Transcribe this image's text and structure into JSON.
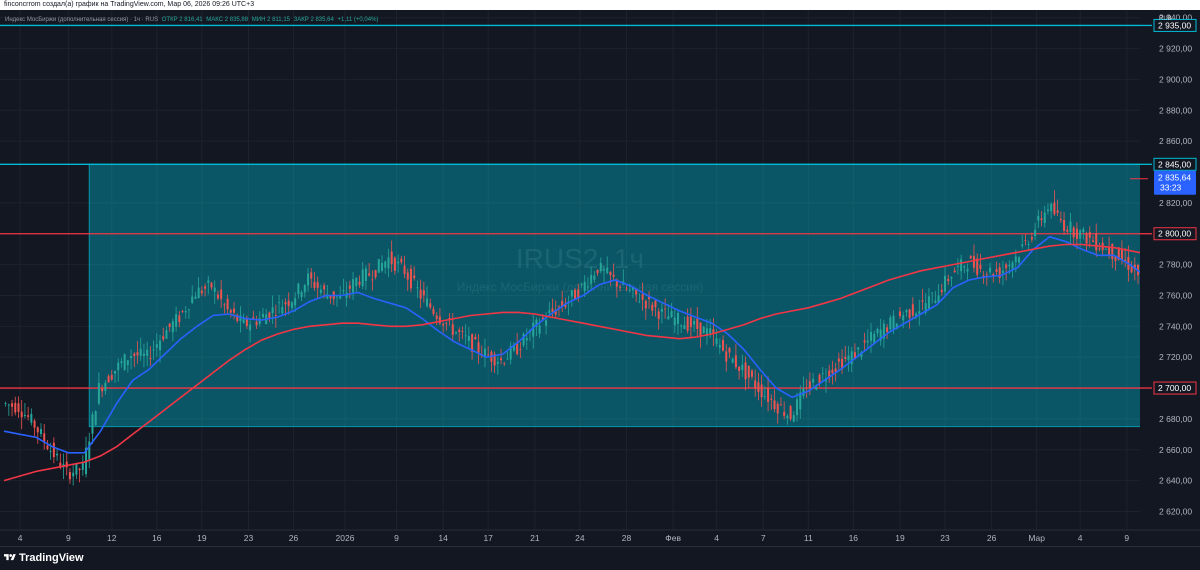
{
  "header": {
    "caption": "finconcrrom создал(а) график на TradingView.com, Мар 06, 2026 09:26 UTC+3"
  },
  "legend": {
    "title": "Индекс МосБиржи (дополнительная сессия) · 1ч · RUS",
    "values": [
      "ОТКР 2 816,41",
      "МАКС 2 835,88",
      "МИН 2 811,15",
      "ЗАКР 2 835,64",
      "+1,11 (+0,04%)"
    ]
  },
  "currency": "RUB",
  "watermark": {
    "symbol": "IRUS2, 1ч",
    "name": "Индекс МосБиржи (дополнительная сессия)"
  },
  "footer": {
    "brand": "TradingView"
  },
  "colors": {
    "background": "#131722",
    "grid": "#1e222d",
    "candle_up": "#26a69a",
    "candle_down": "#ef5350",
    "ma_fast": "#2962ff",
    "ma_slow": "#f23645",
    "box_fill": "#00bcd4",
    "level_cyan": "#00bcd4",
    "level_red": "#f23645"
  },
  "icons": [
    "tradingview-logo-icon"
  ],
  "chart_data": {
    "type": "candlestick",
    "ylim": [
      2608,
      2945
    ],
    "y_ticks": [
      "2 620,00",
      "2 640,00",
      "2 660,00",
      "2 680,00",
      "2 720,00",
      "2 740,00",
      "2 760,00",
      "2 780,00",
      "2 820,00",
      "2 860,00",
      "2 880,00",
      "2 900,00",
      "2 920,00",
      "2 940,00"
    ],
    "x_ticks": [
      {
        "label": "4",
        "i": 1.0
      },
      {
        "label": "9",
        "i": 4.0
      },
      {
        "label": "12",
        "i": 6.7
      },
      {
        "label": "16",
        "i": 9.5
      },
      {
        "label": "19",
        "i": 12.3
      },
      {
        "label": "23",
        "i": 15.2
      },
      {
        "label": "26",
        "i": 18.0
      },
      {
        "label": "2026",
        "i": 21.2
      },
      {
        "label": "9",
        "i": 24.4
      },
      {
        "label": "14",
        "i": 27.3
      },
      {
        "label": "17",
        "i": 30.1
      },
      {
        "label": "21",
        "i": 33.0
      },
      {
        "label": "24",
        "i": 35.8
      },
      {
        "label": "28",
        "i": 38.7
      },
      {
        "label": "Фев",
        "i": 41.6
      },
      {
        "label": "4",
        "i": 44.3
      },
      {
        "label": "7",
        "i": 47.2
      },
      {
        "label": "11",
        "i": 50.0
      },
      {
        "label": "16",
        "i": 52.8
      },
      {
        "label": "19",
        "i": 55.7
      },
      {
        "label": "23",
        "i": 58.5
      },
      {
        "label": "26",
        "i": 61.4
      },
      {
        "label": "Мар",
        "i": 64.2
      },
      {
        "label": "4",
        "i": 66.9
      },
      {
        "label": "9",
        "i": 69.8
      }
    ],
    "index_range": [
      0,
      70
    ],
    "series": [
      {
        "name": "",
        "kind": "price",
        "values": [
          2690,
          2688,
          2676,
          2660,
          2645,
          2648,
          2700,
          2712,
          2722,
          2720,
          2735,
          2746,
          2762,
          2766,
          2750,
          2741,
          2745,
          2752,
          2758,
          2771,
          2762,
          2758,
          2770,
          2775,
          2784,
          2776,
          2760,
          2748,
          2738,
          2730,
          2722,
          2718,
          2726,
          2738,
          2748,
          2755,
          2765,
          2778,
          2770,
          2762,
          2756,
          2748,
          2744,
          2740,
          2735,
          2722,
          2712,
          2700,
          2690,
          2682,
          2700,
          2708,
          2716,
          2722,
          2732,
          2740,
          2748,
          2752,
          2760,
          2774,
          2782,
          2776,
          2775,
          2785,
          2800,
          2818,
          2806,
          2800,
          2794,
          2788,
          2780,
          2770,
          2760,
          2750,
          2730,
          2722,
          2718,
          2728,
          2742,
          2760,
          2778,
          2788,
          2784,
          2770,
          2782,
          2790,
          2786,
          2775,
          2778,
          2788,
          2797,
          2790,
          2784,
          2790,
          2800,
          2808,
          2826,
          2840,
          2832,
          2820,
          2815,
          2818,
          2822,
          2828,
          2835.64
        ]
      },
      {
        "name": "",
        "kind": "ma_fast",
        "values": [
          2672,
          2670,
          2668,
          2662,
          2658,
          2658,
          2672,
          2690,
          2705,
          2712,
          2722,
          2732,
          2740,
          2747,
          2748,
          2745,
          2744,
          2746,
          2750,
          2756,
          2760,
          2760,
          2762,
          2758,
          2755,
          2752,
          2745,
          2737,
          2730,
          2725,
          2720,
          2722,
          2730,
          2740,
          2748,
          2755,
          2760,
          2767,
          2770,
          2766,
          2760,
          2755,
          2750,
          2746,
          2742,
          2735,
          2725,
          2712,
          2700,
          2694,
          2698,
          2705,
          2712,
          2720,
          2728,
          2736,
          2742,
          2748,
          2754,
          2765,
          2770,
          2772,
          2773,
          2778,
          2790,
          2798,
          2795,
          2790,
          2786,
          2786,
          2780,
          2772,
          2762,
          2750,
          2740,
          2730,
          2726,
          2730,
          2740,
          2752,
          2765,
          2772,
          2774,
          2772,
          2776,
          2780,
          2782,
          2780,
          2782,
          2786,
          2790,
          2790,
          2789,
          2792,
          2797,
          2802,
          2812,
          2822,
          2826,
          2822,
          2818,
          2818,
          2821,
          2823,
          2826
        ]
      },
      {
        "name": "",
        "kind": "ma_slow",
        "values": [
          2640,
          2643,
          2646,
          2648,
          2650,
          2652,
          2656,
          2662,
          2670,
          2678,
          2686,
          2694,
          2702,
          2710,
          2718,
          2725,
          2731,
          2735,
          2738,
          2740,
          2741,
          2742,
          2742,
          2741,
          2740,
          2740,
          2741,
          2743,
          2745,
          2747,
          2748,
          2749,
          2749,
          2748,
          2746,
          2744,
          2742,
          2740,
          2738,
          2736,
          2734,
          2733,
          2732,
          2733,
          2735,
          2738,
          2741,
          2745,
          2748,
          2750,
          2752,
          2755,
          2758,
          2762,
          2766,
          2770,
          2773,
          2776,
          2778,
          2780,
          2782,
          2784,
          2786,
          2788,
          2790,
          2792,
          2793,
          2793,
          2792,
          2791,
          2789,
          2787,
          2784,
          2780,
          2774,
          2769,
          2764,
          2760,
          2758,
          2757,
          2758,
          2760,
          2762,
          2764,
          2766,
          2768,
          2770,
          2772,
          2774,
          2776,
          2778,
          2780,
          2782,
          2785,
          2788,
          2791,
          2794,
          2797,
          2800,
          2802,
          2803,
          2805,
          2806,
          2808,
          2810
        ]
      }
    ],
    "levels": [
      {
        "value": 2935.0,
        "label": "2 935,00",
        "color": "#00bcd4"
      },
      {
        "value": 2845.0,
        "label": "2 845,00",
        "color": "#00bcd4"
      },
      {
        "value": 2800.0,
        "label": "2 800,00",
        "color": "#f23645"
      },
      {
        "value": 2700.0,
        "label": "2 700,00",
        "color": "#f23645"
      }
    ],
    "box": {
      "top": 2845,
      "bottom": 2675,
      "i_start": 5.3,
      "i_end": 71.8
    },
    "last_price": {
      "value": 2835.64,
      "label": "2 835,64",
      "countdown": "33:23"
    }
  }
}
